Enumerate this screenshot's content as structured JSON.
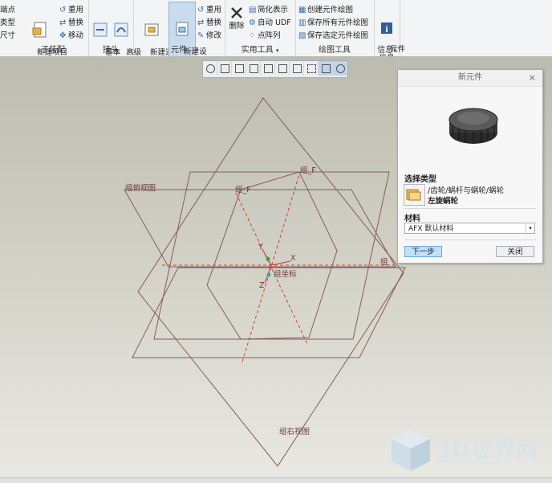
{
  "ribbon": {
    "edge_items": [
      "端点",
      "类型",
      "尺寸"
    ],
    "subassembly": {
      "new_project": "新建项目\n子装配",
      "reuse": "重用",
      "replace": "替换",
      "move": "移动",
      "label": "子装配"
    },
    "connector": {
      "basic": "基本\n接头",
      "advanced": "高级\n接头",
      "label": "接头"
    },
    "component": {
      "new_connector": "新建连接\n器元素",
      "new_device": "新建设\n备元素",
      "reuse": "重用",
      "replace": "替换",
      "modify": "修改",
      "label": "元件"
    },
    "utilities": {
      "delete": "删除",
      "simplified": "简化表示",
      "auto_udf": "自动 UDF",
      "point_array": "点阵列",
      "label": "实用工具",
      "dropdown": "▾"
    },
    "drawing": {
      "create": "创建元件绘图",
      "save_all": "保存所有元件绘图",
      "save_selected": "保存选定元件绘图",
      "label": "绘图工具"
    },
    "info": {
      "component_info": "元件\n信息",
      "label": "信息",
      "dropdown": "▾"
    }
  },
  "viewport": {
    "datum_labels": {
      "top_view": "组俯视图",
      "right_view": "组右视图",
      "front_a": "组_F",
      "front_b": "组_F",
      "side": "组",
      "csys": "组坐标",
      "y": "Y",
      "x": "X",
      "z": "Z"
    }
  },
  "dialog": {
    "title": "新元件",
    "close": "×",
    "select_type_label": "选择类型",
    "type_path": "/齿轮/蜗杆与蜗轮/蜗轮",
    "type_name": "左旋蜗轮",
    "material_label": "材料",
    "material_value": "AFX 默认材料",
    "next_button": "下一步",
    "close_button": "关闭"
  },
  "watermark": {
    "text": "3D世界网",
    "url": "WWW.3DSJW.COM"
  },
  "colors": {
    "accent": "#3a6ea5",
    "primary_button": "#bfe0f7",
    "datum_plane": "#8a5a5a",
    "axis_dashed": "#d23a3a"
  }
}
